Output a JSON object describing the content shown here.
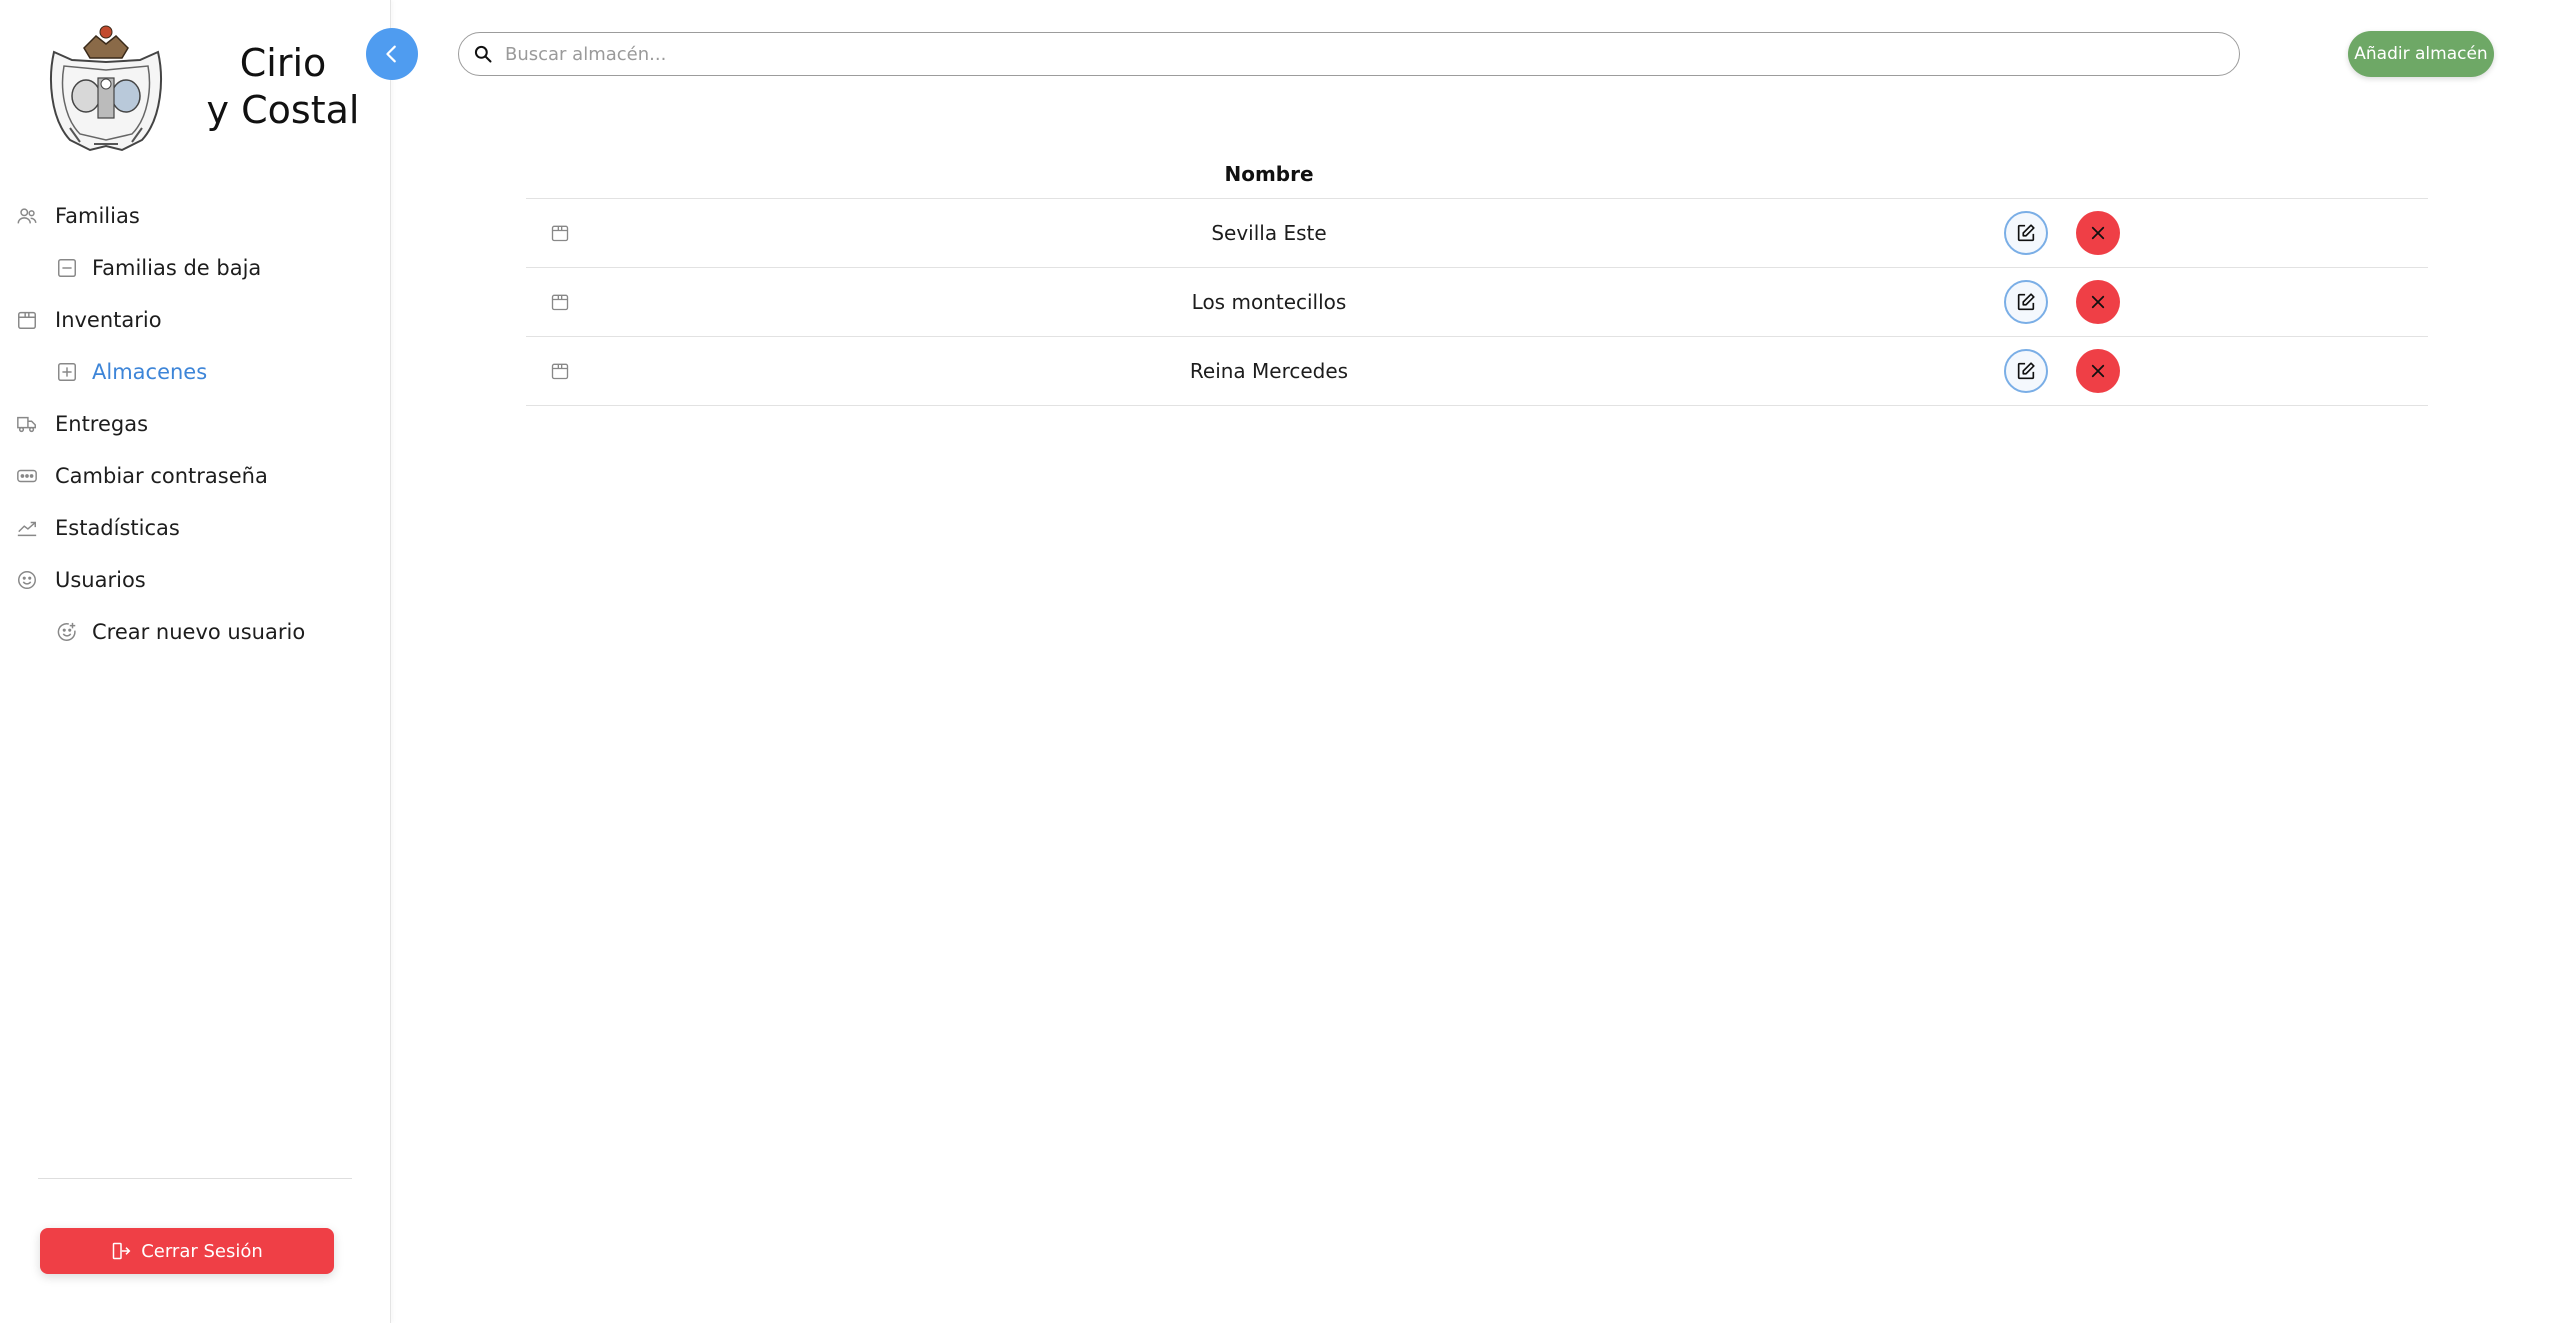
{
  "brand": {
    "title_line1": "Cirio",
    "title_line2": "y Costal",
    "logo_icon": "coat-of-arms-logo"
  },
  "sidebar": {
    "collapse_icon": "chevron-left-icon",
    "items": [
      {
        "label": "Familias",
        "icon": "users-icon",
        "sub": false,
        "active": false
      },
      {
        "label": "Familias de baja",
        "icon": "minus-square-icon",
        "sub": true,
        "active": false
      },
      {
        "label": "Inventario",
        "icon": "box-icon",
        "sub": false,
        "active": false
      },
      {
        "label": "Almacenes",
        "icon": "plus-square-icon",
        "sub": true,
        "active": true
      },
      {
        "label": "Entregas",
        "icon": "truck-icon",
        "sub": false,
        "active": false
      },
      {
        "label": "Cambiar contraseña",
        "icon": "password-icon",
        "sub": false,
        "active": false
      },
      {
        "label": "Estadísticas",
        "icon": "trend-chart-icon",
        "sub": false,
        "active": false
      },
      {
        "label": "Usuarios",
        "icon": "smile-icon",
        "sub": false,
        "active": false
      },
      {
        "label": "Crear nuevo usuario",
        "icon": "smile-plus-icon",
        "sub": true,
        "active": false
      }
    ],
    "logout_label": "Cerrar Sesión",
    "logout_icon": "logout-icon"
  },
  "search": {
    "placeholder": "Buscar almacén...",
    "value": ""
  },
  "add_button": {
    "label": "Añadir almacén"
  },
  "table": {
    "header_name": "Nombre",
    "rows": [
      {
        "name": "Sevilla Este"
      },
      {
        "name": "Los montecillos"
      },
      {
        "name": "Reina Mercedes"
      }
    ]
  },
  "colors": {
    "accent_blue": "#4f9cf0",
    "active_text": "#3d85d8",
    "add_green": "#6ea866",
    "danger_red": "#ef3f46"
  }
}
